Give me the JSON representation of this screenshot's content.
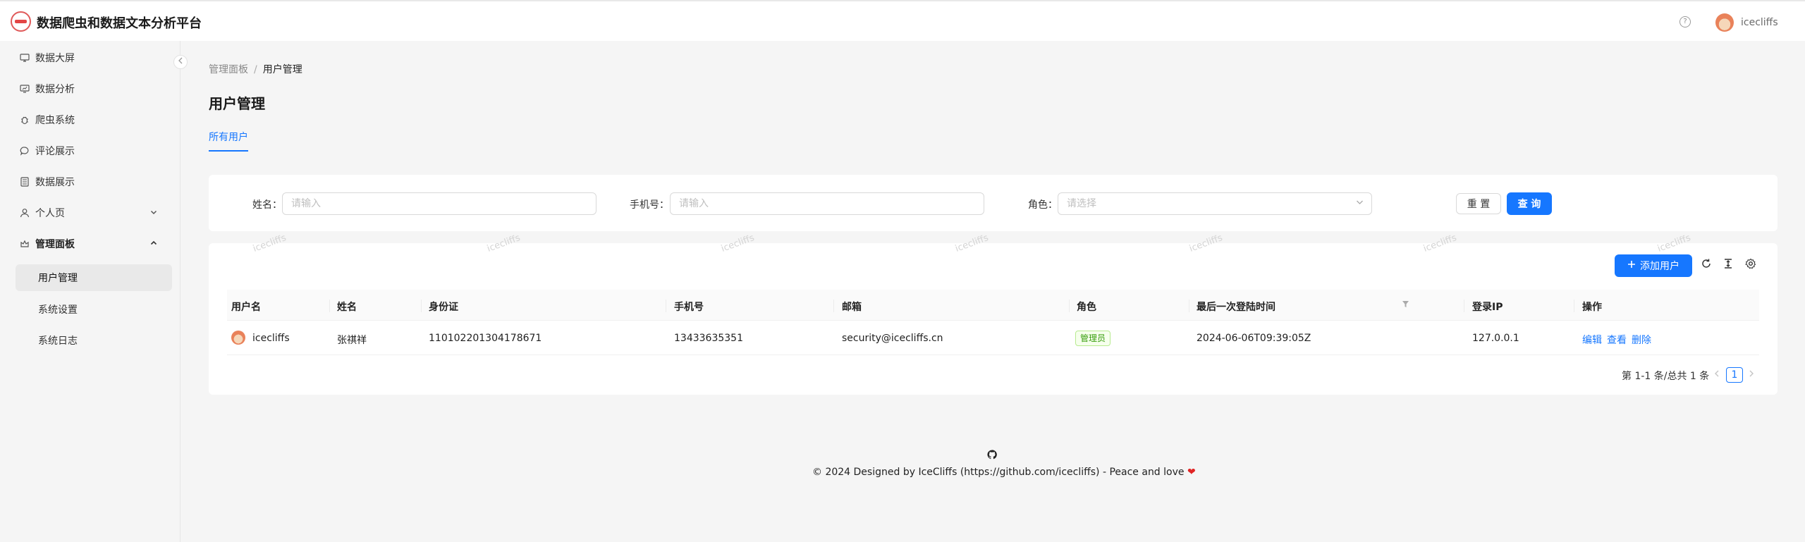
{
  "app": {
    "title": "数据爬虫和数据文本分析平台",
    "logo_icon": "app-logo",
    "accent": "#1677ff"
  },
  "header": {
    "help_icon": "question-circle-icon",
    "user": {
      "name": "icecliffs"
    }
  },
  "sidebar": {
    "items": [
      {
        "label": "数据大屏",
        "icon": "dashboard-icon"
      },
      {
        "label": "数据分析",
        "icon": "analysis-icon"
      },
      {
        "label": "爬虫系统",
        "icon": "bug-icon"
      },
      {
        "label": "评论展示",
        "icon": "comment-icon"
      },
      {
        "label": "数据展示",
        "icon": "list-icon"
      },
      {
        "label": "个人页",
        "icon": "user-icon"
      },
      {
        "label": "管理面板",
        "icon": "crown-icon"
      }
    ],
    "sub_items": [
      "用户管理",
      "系统设置",
      "系统日志"
    ]
  },
  "breadcrumb": {
    "parent": "管理面板",
    "current": "用户管理",
    "sep": "/"
  },
  "page": {
    "title": "用户管理",
    "tab": "所有用户"
  },
  "search": {
    "name_label": "姓名：",
    "name_placeholder": "请输入",
    "phone_label": "手机号：",
    "phone_placeholder": "请输入",
    "role_label": "角色：",
    "role_placeholder": "请选择",
    "reset": "重 置",
    "query": "查 询"
  },
  "watermark": "icecliffs",
  "toolbar": {
    "add_user": "添加用户"
  },
  "table": {
    "columns": [
      "用户名",
      "姓名",
      "身份证",
      "手机号",
      "邮箱",
      "角色",
      "最后一次登陆时间",
      "登录IP",
      "操作"
    ],
    "rows": [
      {
        "username": "icecliffs",
        "name": "张祺祥",
        "id_card": "110102201304178671",
        "phone": "13433635351",
        "email": "security@icecliffs.cn",
        "role": "管理员",
        "last_login": "2024-06-06T09:39:05Z",
        "ip": "127.0.0.1",
        "actions": [
          "编辑",
          "查看",
          "删除"
        ]
      }
    ]
  },
  "pagination": {
    "total_text": "第 1-1 条/总共 1 条",
    "current": "1"
  },
  "footer": {
    "text": "© 2024 Designed by IceCliffs (https://github.com/icecliffs) - Peace and love",
    "heart": "❤"
  }
}
